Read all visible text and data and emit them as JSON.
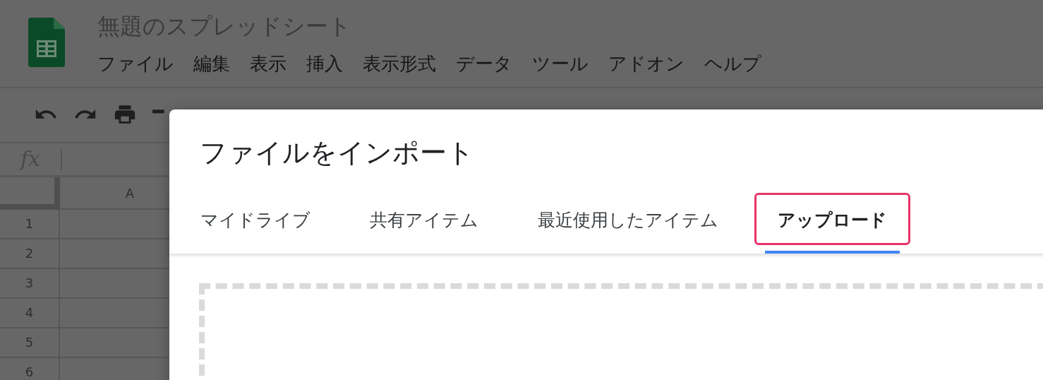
{
  "app": {
    "title": "無題のスプレッドシート"
  },
  "menu": [
    "ファイル",
    "編集",
    "表示",
    "挿入",
    "表示形式",
    "データ",
    "ツール",
    "アドオン",
    "ヘルプ"
  ],
  "formula_label": "fx",
  "grid": {
    "columns": [
      "A"
    ],
    "rows": [
      "1",
      "2",
      "3",
      "4",
      "5",
      "6"
    ]
  },
  "dialog": {
    "title": "ファイルをインポート",
    "tabs": [
      {
        "label": "マイドライブ",
        "selected": false
      },
      {
        "label": "共有アイテム",
        "selected": false
      },
      {
        "label": "最近使用したアイテム",
        "selected": false
      },
      {
        "label": "アップロード",
        "selected": true,
        "highlighted": true
      }
    ]
  }
}
